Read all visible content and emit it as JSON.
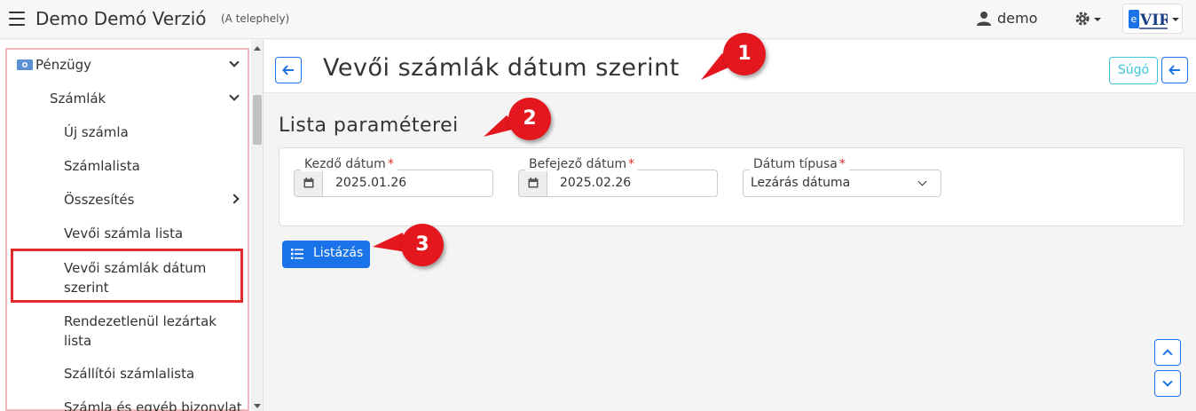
{
  "topbar": {
    "app_title": "Demo Demó Verzió",
    "app_subtitle": "(A telephely)",
    "user_name": "demo",
    "logo_text": "eVIR"
  },
  "sidebar": {
    "items": [
      {
        "label": "Pénzügy",
        "level": 1,
        "state": "expanded"
      },
      {
        "label": "Számlák",
        "level": 2,
        "state": "expanded"
      },
      {
        "label": "Új számla",
        "level": 3
      },
      {
        "label": "Számlalista",
        "level": 3
      },
      {
        "label": "Összesítés",
        "level": 3,
        "state": "collapsed"
      },
      {
        "label": "Vevői számla lista",
        "level": 3
      },
      {
        "label": "Vevői számlák dátum szerint",
        "level": 3,
        "active": true
      },
      {
        "label": "Rendezetlenül lezártak lista",
        "level": 3
      },
      {
        "label": "Szállítói számlalista",
        "level": 3
      },
      {
        "label": "Számla és egyéb bizonylat",
        "level": 3
      }
    ]
  },
  "header": {
    "title": "Vevői számlák dátum szerint",
    "help_label": "Súgó"
  },
  "params": {
    "section_title": "Lista paraméterei",
    "start_date_label": "Kezdő dátum",
    "start_date_value": "2025.01.26",
    "end_date_label": "Befejező dátum",
    "end_date_value": "2025.02.26",
    "date_type_label": "Dátum típusa",
    "date_type_value": "Lezárás dátuma",
    "required_mark": "*"
  },
  "actions": {
    "list_label": "Listázás"
  },
  "callouts": [
    "1",
    "2",
    "3"
  ],
  "colors": {
    "primary": "#1a73e8",
    "help": "#3ec6d8",
    "callout": "#e4161e",
    "highlight": "#e02b2b"
  }
}
